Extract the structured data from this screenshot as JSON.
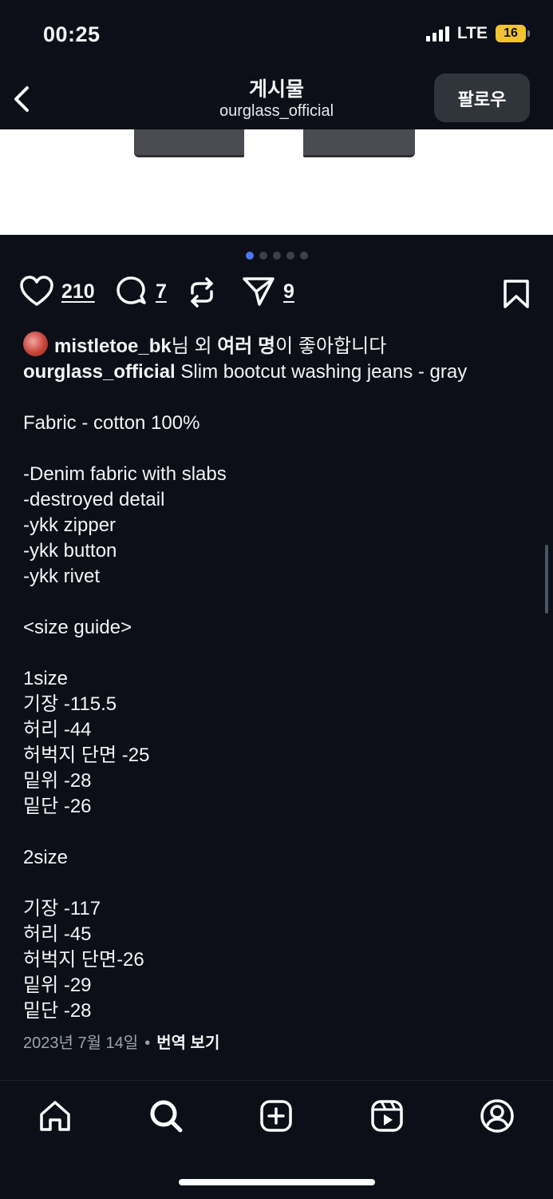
{
  "status_bar": {
    "time": "00:25",
    "network": "LTE",
    "battery": "16"
  },
  "header": {
    "title": "게시물",
    "username": "ourglass_official",
    "follow_label": "팔로우"
  },
  "carousel": {
    "total": 5,
    "active_index": 0
  },
  "actions": {
    "likes": "210",
    "comments": "7",
    "shares": "9"
  },
  "liked_by": {
    "username": "mistletoe_bk",
    "suffix_1": "님 외 ",
    "bold_part": "여러 명",
    "suffix_2": "이 좋아합니다"
  },
  "caption": {
    "username": "ourglass_official",
    "first_line": " Slim bootcut washing jeans - gray",
    "lines": [
      "",
      "Fabric - cotton 100%",
      "",
      "-Denim fabric with slabs",
      "-destroyed detail",
      "-ykk zipper",
      "-ykk button",
      "-ykk rivet",
      "",
      "<size guide>",
      "",
      "1size",
      "기장 -115.5",
      "허리 -44",
      "허벅지 단면 -25",
      "밑위 -28",
      "밑단 -26",
      "",
      "2size",
      "",
      "기장 -117",
      "허리 -45",
      "허벅지 단면-26",
      "밑위 -29",
      "밑단 -28"
    ]
  },
  "footer": {
    "date": "2023년 7월 14일",
    "separator": "•",
    "translate_label": "번역 보기"
  },
  "tabbar": [
    "home-icon",
    "search-icon",
    "create-icon",
    "reels-icon",
    "profile-icon"
  ],
  "colors": {
    "background": "#0c0f17",
    "accent_dot": "#4a79f0",
    "battery": "#f1c232"
  }
}
